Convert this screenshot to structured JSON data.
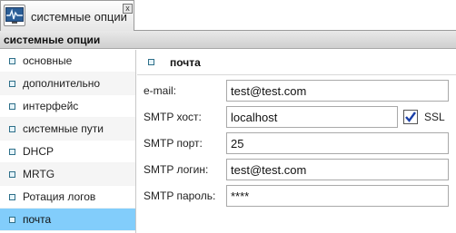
{
  "tab": {
    "label": "системные опции",
    "close_symbol": "x",
    "icon": "monitor-graph-icon"
  },
  "panel": {
    "title": "системные опции"
  },
  "sidebar": {
    "items": [
      {
        "label": "основные"
      },
      {
        "label": "дополнительно"
      },
      {
        "label": "интерфейс"
      },
      {
        "label": "системные пути"
      },
      {
        "label": "DHCP"
      },
      {
        "label": "MRTG"
      },
      {
        "label": "Ротация логов"
      },
      {
        "label": "почта",
        "active": true
      }
    ]
  },
  "mail": {
    "title": "почта",
    "email_label": "e-mail:",
    "email_value": "test@test.com",
    "smtp_host_label": "SMTP хост:",
    "smtp_host_value": "localhost",
    "ssl_label": "SSL",
    "ssl_checked": true,
    "smtp_port_label": "SMTP порт:",
    "smtp_port_value": "25",
    "smtp_login_label": "SMTP логин:",
    "smtp_login_value": "test@test.com",
    "smtp_password_label": "SMTP пароль:",
    "smtp_password_value": "****"
  },
  "colors": {
    "active_item": "#82cdfb",
    "bullet_border": "#2e6f89",
    "checkmark": "#1a3fa8"
  }
}
